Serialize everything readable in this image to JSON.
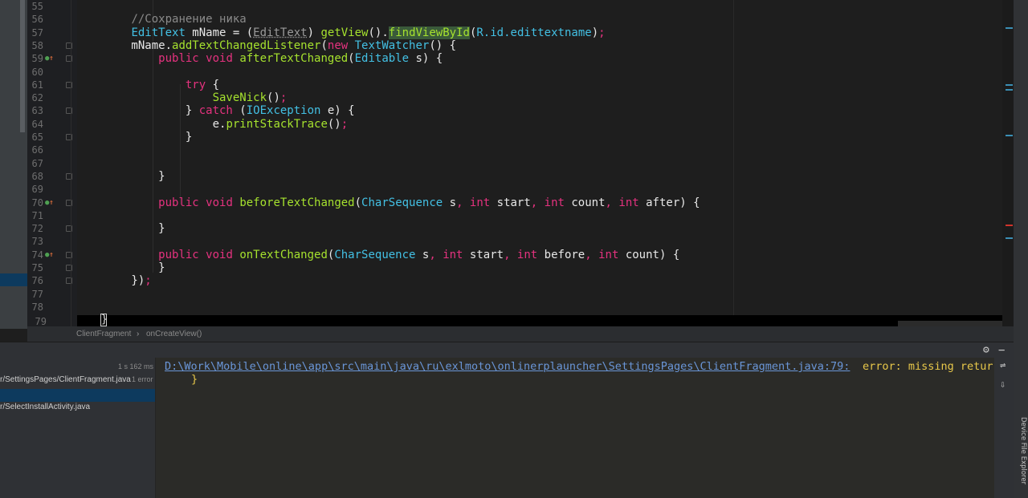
{
  "editor": {
    "lines": [
      {
        "num": "55",
        "tokens": []
      },
      {
        "num": "56",
        "tokens": [
          {
            "t": "        "
          },
          {
            "c": "cm",
            "t": "//Сохранение ника"
          }
        ]
      },
      {
        "num": "57",
        "tokens": [
          {
            "t": "        "
          },
          {
            "c": "ty",
            "t": "EditText"
          },
          {
            "t": " mName = ("
          },
          {
            "c": "un",
            "t": "EditText"
          },
          {
            "t": ") "
          },
          {
            "c": "fn",
            "t": "getView"
          },
          {
            "t": "()."
          },
          {
            "c": "hl",
            "t": "findViewById"
          },
          {
            "t": "("
          },
          {
            "c": "ty",
            "t": "R.id."
          },
          {
            "c": "ty",
            "t": "edittextname"
          },
          {
            "t": ")"
          },
          {
            "c": "kw",
            "t": ";"
          }
        ]
      },
      {
        "num": "58",
        "tokens": [
          {
            "t": "        mName."
          },
          {
            "c": "fn",
            "t": "addTextChangedListener"
          },
          {
            "t": "("
          },
          {
            "c": "kw",
            "t": "new "
          },
          {
            "c": "ty",
            "t": "TextWatcher"
          },
          {
            "t": "() {"
          }
        ]
      },
      {
        "num": "59",
        "tokens": [
          {
            "t": "            "
          },
          {
            "c": "kw",
            "t": "public void "
          },
          {
            "c": "fn",
            "t": "afterTextChanged"
          },
          {
            "t": "("
          },
          {
            "c": "ty",
            "t": "Editable"
          },
          {
            "t": " s) {"
          }
        ]
      },
      {
        "num": "60",
        "tokens": []
      },
      {
        "num": "61",
        "tokens": [
          {
            "t": "                "
          },
          {
            "c": "kw",
            "t": "try"
          },
          {
            "t": " {"
          }
        ]
      },
      {
        "num": "62",
        "tokens": [
          {
            "t": "                    "
          },
          {
            "c": "fn",
            "t": "SaveNick"
          },
          {
            "t": "()"
          },
          {
            "c": "kw",
            "t": ";"
          }
        ]
      },
      {
        "num": "63",
        "tokens": [
          {
            "t": "                } "
          },
          {
            "c": "kw",
            "t": "catch"
          },
          {
            "t": " ("
          },
          {
            "c": "ty",
            "t": "IOException"
          },
          {
            "t": " e) {"
          }
        ]
      },
      {
        "num": "64",
        "tokens": [
          {
            "t": "                    e."
          },
          {
            "c": "fn",
            "t": "printStackTrace"
          },
          {
            "t": "()"
          },
          {
            "c": "kw",
            "t": ";"
          }
        ]
      },
      {
        "num": "65",
        "tokens": [
          {
            "t": "                }"
          }
        ]
      },
      {
        "num": "66",
        "tokens": []
      },
      {
        "num": "67",
        "tokens": []
      },
      {
        "num": "68",
        "tokens": [
          {
            "t": "            }"
          }
        ]
      },
      {
        "num": "69",
        "tokens": []
      },
      {
        "num": "70",
        "tokens": [
          {
            "t": "            "
          },
          {
            "c": "kw",
            "t": "public void "
          },
          {
            "c": "fn",
            "t": "beforeTextChanged"
          },
          {
            "t": "("
          },
          {
            "c": "ty",
            "t": "CharSequence"
          },
          {
            "t": " s"
          },
          {
            "c": "kw",
            "t": ", int "
          },
          {
            "t": "start"
          },
          {
            "c": "kw",
            "t": ", int "
          },
          {
            "t": "count"
          },
          {
            "c": "kw",
            "t": ", int "
          },
          {
            "t": "after) {"
          }
        ]
      },
      {
        "num": "71",
        "tokens": []
      },
      {
        "num": "72",
        "tokens": [
          {
            "t": "            }"
          }
        ]
      },
      {
        "num": "73",
        "tokens": []
      },
      {
        "num": "74",
        "tokens": [
          {
            "t": "            "
          },
          {
            "c": "kw",
            "t": "public void "
          },
          {
            "c": "fn",
            "t": "onTextChanged"
          },
          {
            "t": "("
          },
          {
            "c": "ty",
            "t": "CharSequence"
          },
          {
            "t": " s"
          },
          {
            "c": "kw",
            "t": ", int "
          },
          {
            "t": "start"
          },
          {
            "c": "kw",
            "t": ", int "
          },
          {
            "t": "before"
          },
          {
            "c": "kw",
            "t": ", int "
          },
          {
            "t": "count) {"
          }
        ]
      },
      {
        "num": "75",
        "tokens": [
          {
            "t": "            }"
          }
        ]
      },
      {
        "num": "76",
        "tokens": [
          {
            "t": "        })"
          },
          {
            "c": "kw",
            "t": ";"
          }
        ]
      },
      {
        "num": "77",
        "tokens": []
      },
      {
        "num": "78",
        "tokens": []
      }
    ],
    "last_line_num": "79",
    "caret_char": "}",
    "override_lines": [
      "59",
      "70",
      "74"
    ]
  },
  "breadcrumbs": {
    "items": [
      "ClientFragment",
      "onCreateView()"
    ],
    "separator": "›"
  },
  "build": {
    "time": "1 s 162 ms",
    "tree": [
      {
        "label": "r/SettingsPages/ClientFragment.java",
        "badge": "1 error"
      },
      {
        "label": "r/SelectInstallActivity.java",
        "badge": ""
      }
    ],
    "output_path": "D:\\Work\\Mobile\\online\\app\\src\\main\\java\\ru\\exlmoto\\onlinerplauncher\\SettingsPages\\ClientFragment.java:79:",
    "output_error": "error: missing retur",
    "output_brace": "}"
  },
  "tool_window": {
    "device_file_explorer": "Device File Explorer"
  },
  "icons": {
    "settings": "gear-icon",
    "minimize": "minimize-icon",
    "override": "override-method-icon"
  },
  "colors": {
    "keyword": "#e5327f",
    "type": "#43c0e4",
    "function": "#a6e22e",
    "comment": "#8a8a8a",
    "error": "#e8c84a",
    "link": "#6a96d8"
  }
}
